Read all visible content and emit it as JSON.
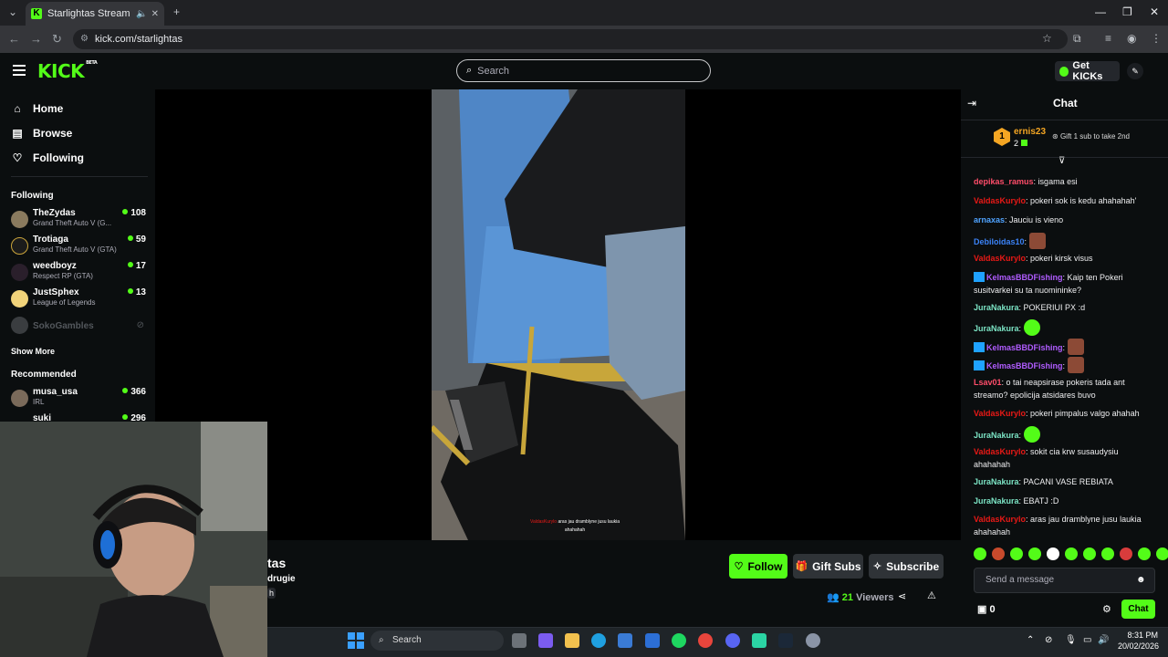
{
  "browser": {
    "tab_title": "Starlightas Stream - Watch",
    "url": "kick.com/starlightas"
  },
  "header": {
    "logo_text": "KICK",
    "logo_badge": "BETA",
    "search_placeholder": "Search",
    "get_kicks_label": "Get KICKs"
  },
  "sidebar": {
    "nav": [
      {
        "label": "Home",
        "icon": "home-icon"
      },
      {
        "label": "Browse",
        "icon": "browse-icon"
      },
      {
        "label": "Following",
        "icon": "heart-icon"
      }
    ],
    "following_heading": "Following",
    "following": [
      {
        "name": "TheZydas",
        "game": "Grand Theft Auto V (G...",
        "viewers": "108"
      },
      {
        "name": "Trotiaga",
        "game": "Grand Theft Auto V (GTA)",
        "viewers": "59"
      },
      {
        "name": "weedboyz",
        "game": "Respect RP (GTA)",
        "viewers": "17"
      },
      {
        "name": "JustSphex",
        "game": "League of Legends",
        "viewers": "13"
      },
      {
        "name": "SokoGambles",
        "game": "",
        "viewers": ""
      }
    ],
    "show_more": "Show More",
    "recommended_heading": "Recommended",
    "recommended": [
      {
        "name": "musa_usa",
        "game": "IRL",
        "viewers": "366"
      },
      {
        "name": "suki",
        "game": "",
        "viewers": "296"
      }
    ]
  },
  "video": {
    "caption_user": "ValdasKurylo",
    "caption_text": "aras jau dramblyne jusu laukia ahahahah"
  },
  "stream": {
    "name_partial": "tas",
    "title_partial": "drugie",
    "category_partial": "h",
    "follow_label": "Follow",
    "gift_label": "Gift Subs",
    "subscribe_label": "Subscribe",
    "viewers_count": "21",
    "viewers_label": "Viewers"
  },
  "chat": {
    "title": "Chat",
    "top_gifter_rank": "1",
    "top_gifter_name": "ernis23",
    "top_gifter_count": "2",
    "gift_hint": "Gift 1 sub to take 2nd",
    "messages": [
      {
        "user": "depikas_ramus",
        "color": "#ff4d6a",
        "text": "isgama esi",
        "badge": false,
        "emote": ""
      },
      {
        "user": "ValdasKurylo",
        "color": "#e91916",
        "text": "pokeri sok is kedu ahahahah'",
        "badge": false,
        "emote": ""
      },
      {
        "user": "arnaxas",
        "color": "#4fa3ff",
        "text": "Jauciu is vieno",
        "badge": false,
        "emote": ""
      },
      {
        "user": "Debiloidas10",
        "color": "#3b82f6",
        "text": "",
        "badge": false,
        "emote": "photo"
      },
      {
        "user": "ValdasKurylo",
        "color": "#e91916",
        "text": "pokeri kirsk visus",
        "badge": false,
        "emote": ""
      },
      {
        "user": "KelmasBBDFishing",
        "color": "#b05cff",
        "text": "Kaip ten Pokeri susitvarkei su ta nuomininke?",
        "badge": true,
        "emote": ""
      },
      {
        "user": "JuraNakura",
        "color": "#7be3c4",
        "text": "POKERIUI PX :d",
        "badge": false,
        "emote": ""
      },
      {
        "user": "JuraNakura",
        "color": "#7be3c4",
        "text": "",
        "badge": false,
        "emote": "green"
      },
      {
        "user": "KelmasBBDFishing",
        "color": "#b05cff",
        "text": "",
        "badge": true,
        "emote": "photo"
      },
      {
        "user": "KelmasBBDFishing",
        "color": "#b05cff",
        "text": "",
        "badge": true,
        "emote": "photo"
      },
      {
        "user": "Lsav01",
        "color": "#ff4d6a",
        "text": "o tai neapsirase pokeris tada ant streamo? epolicija atsidares buvo",
        "badge": false,
        "emote": ""
      },
      {
        "user": "ValdasKurylo",
        "color": "#e91916",
        "text": "pokeri pimpalus valgo ahahah",
        "badge": false,
        "emote": ""
      },
      {
        "user": "JuraNakura",
        "color": "#7be3c4",
        "text": "",
        "badge": false,
        "emote": "green"
      },
      {
        "user": "ValdasKurylo",
        "color": "#e91916",
        "text": "sokit cia krw susaudysiu ahahahah",
        "badge": false,
        "emote": ""
      },
      {
        "user": "JuraNakura",
        "color": "#7be3c4",
        "text": "PACANI VASE REBIATA",
        "badge": false,
        "emote": ""
      },
      {
        "user": "JuraNakura",
        "color": "#7be3c4",
        "text": "EBATJ :D",
        "badge": false,
        "emote": ""
      },
      {
        "user": "ValdasKurylo",
        "color": "#e91916",
        "text": "aras jau dramblyne jusu laukia ahahahah",
        "badge": false,
        "emote": ""
      }
    ],
    "input_placeholder": "Send a message",
    "kicks_balance": "0",
    "send_label": "Chat"
  },
  "taskbar": {
    "search_label": "Search",
    "time": "8:31 PM",
    "date": "20/02/2026"
  },
  "colors": {
    "accent": "#53fc18",
    "background": "#0b0e0f"
  }
}
